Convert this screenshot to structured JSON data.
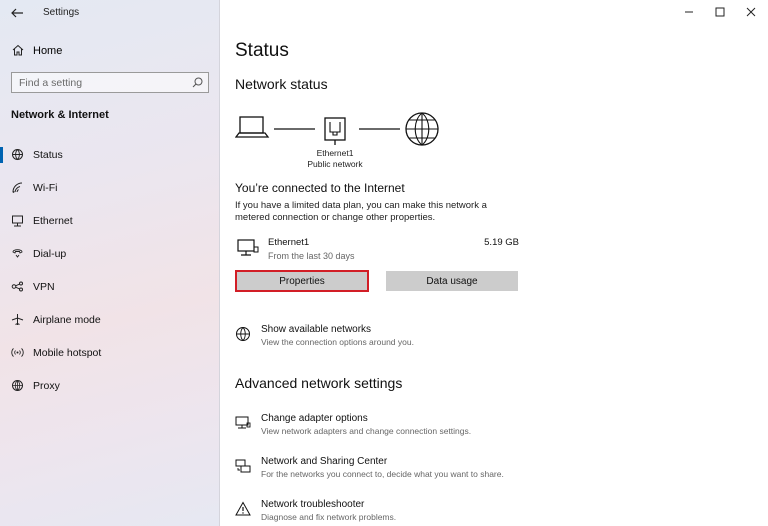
{
  "window": {
    "app_title": "Settings"
  },
  "sidebar": {
    "home_label": "Home",
    "search_placeholder": "Find a setting",
    "section_header": "Network & Internet",
    "items": [
      {
        "label": "Status",
        "icon": "globe-status-icon",
        "selected": true
      },
      {
        "label": "Wi-Fi",
        "icon": "wifi-icon",
        "selected": false
      },
      {
        "label": "Ethernet",
        "icon": "ethernet-icon",
        "selected": false
      },
      {
        "label": "Dial-up",
        "icon": "phone-icon",
        "selected": false
      },
      {
        "label": "VPN",
        "icon": "vpn-icon",
        "selected": false
      },
      {
        "label": "Airplane mode",
        "icon": "airplane-icon",
        "selected": false
      },
      {
        "label": "Mobile hotspot",
        "icon": "hotspot-icon",
        "selected": false
      },
      {
        "label": "Proxy",
        "icon": "globe-icon",
        "selected": false
      }
    ]
  },
  "main": {
    "title": "Status",
    "network_status_header": "Network status",
    "diagram": {
      "adapter_name": "Ethernet1",
      "network_type": "Public network"
    },
    "connected_heading": "You’re connected to the Internet",
    "connected_desc_line1": "If you have a limited data plan, you can make this network a",
    "connected_desc_line2": "metered connection or change other properties.",
    "adapter": {
      "name": "Ethernet1",
      "usage_period": "From the last 30 days",
      "data_used": "5.19 GB"
    },
    "properties_button": "Properties",
    "data_usage_button": "Data usage",
    "show_networks": {
      "title": "Show available networks",
      "desc": "View the connection options around you."
    },
    "advanced_header": "Advanced network settings",
    "advanced_items": [
      {
        "title": "Change adapter options",
        "desc": "View network adapters and change connection settings.",
        "icon": "adapter-icon"
      },
      {
        "title": "Network and Sharing Center",
        "desc": "For the networks you connect to, decide what you want to share.",
        "icon": "sharing-center-icon"
      },
      {
        "title": "Network troubleshooter",
        "desc": "Diagnose and fix network problems.",
        "icon": "warning-icon"
      }
    ]
  },
  "colors": {
    "accent": "#0063b1",
    "highlight_border": "#d21e26",
    "button_bg": "#cccccc"
  }
}
